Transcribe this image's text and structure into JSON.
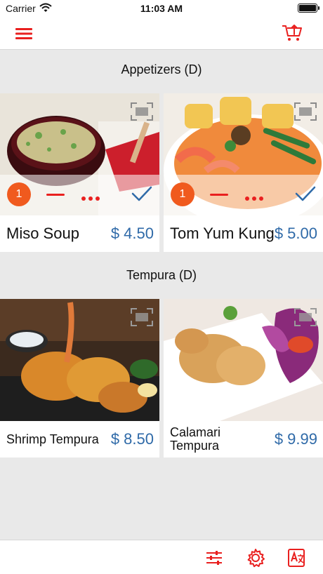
{
  "status_bar": {
    "carrier": "Carrier",
    "time": "11:03 AM"
  },
  "nav": {
    "menu_icon": "hamburger-menu-icon",
    "cart_icon": "shopping-cart-icon",
    "accent_color": "#e9201f"
  },
  "sections": [
    {
      "title": "Appetizers (D)",
      "items": [
        {
          "name": "Miso Soup",
          "price": "$ 4.50",
          "quantity": "1",
          "selected": true
        },
        {
          "name": "Tom Yum Kung",
          "price": "$ 5.00",
          "quantity": "1",
          "selected": true
        }
      ]
    },
    {
      "title": "Tempura (D)",
      "items": [
        {
          "name": "Shrimp Tempura",
          "price": "$ 8.50"
        },
        {
          "name": "Calamari Tempura",
          "price": "$ 9.99"
        }
      ]
    }
  ],
  "tab_bar": {
    "icons": [
      "filter-sliders-icon",
      "settings-gear-icon",
      "translate-icon"
    ]
  },
  "colors": {
    "price": "#2f6aa8",
    "badge": "#f05a1e",
    "background": "#e9e9e9"
  }
}
